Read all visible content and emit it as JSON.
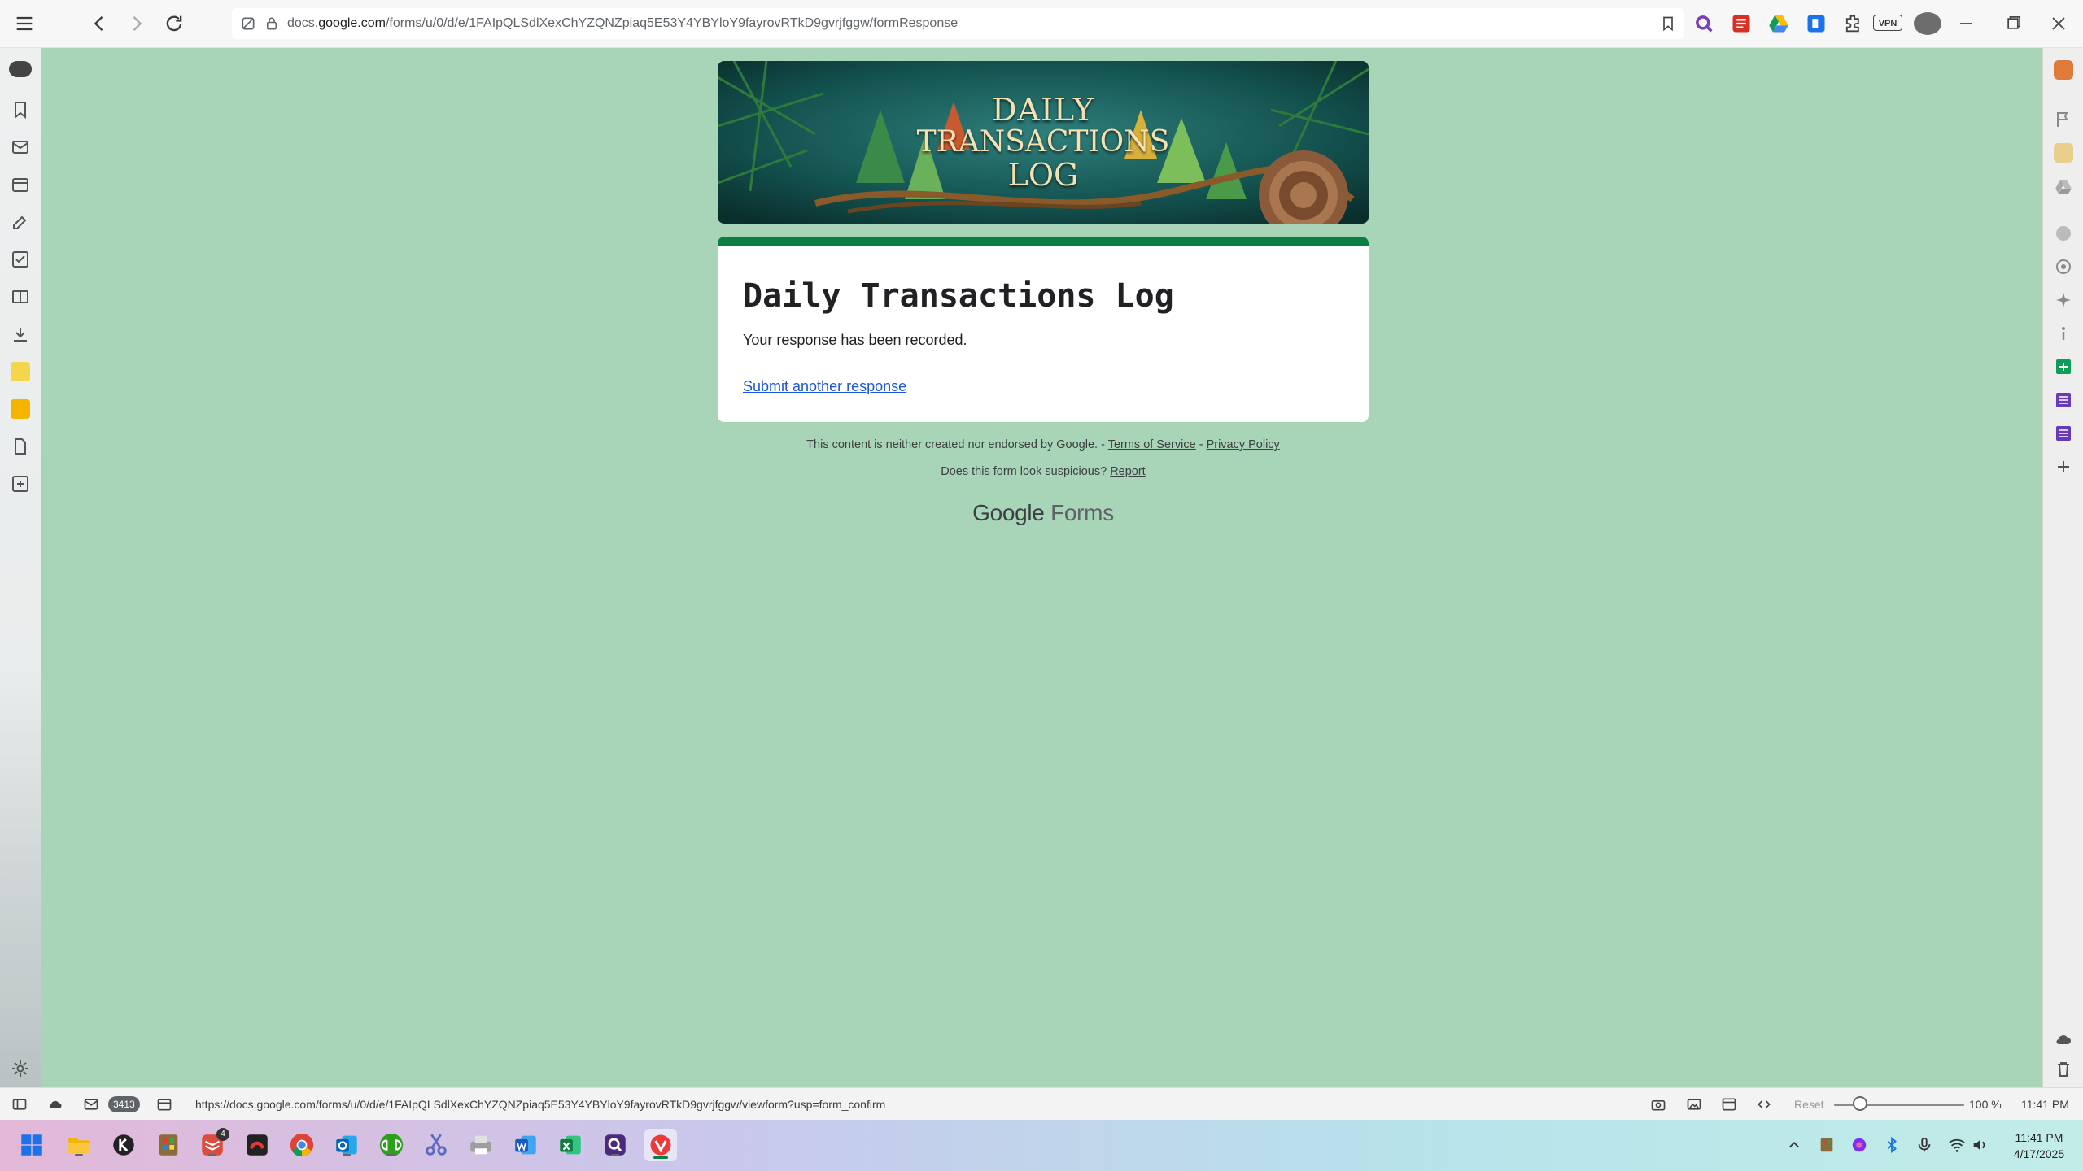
{
  "browser": {
    "url_host_prefix": "docs.",
    "url_host": "google.com",
    "url_path": "/forms/u/0/d/e/1FAIpQLSdlXexChYZQNZpiaq5E53Y4YBYloY9fayrovRTkD9gvrjfggw/formResponse",
    "icons": [
      "menu-icon",
      "back-icon",
      "forward-icon",
      "reload-icon",
      "site-info-icon",
      "lock-icon",
      "bookmark-icon"
    ],
    "extensions": [
      "search-extension-icon",
      "pdf-extension-icon",
      "drive-extension-icon",
      "extension-badge-icon",
      "puzzle-icon"
    ],
    "vpn_label": "VPN"
  },
  "form": {
    "banner_line1": "DAILY",
    "banner_line2": "TRANSACTIONS",
    "banner_line3": "LOG",
    "title": "Daily Transactions Log",
    "confirmation": "Your response has been recorded.",
    "another_link": "Submit another response",
    "accent_color": "#0b8043",
    "background_color": "#a8d5b7"
  },
  "footer": {
    "disclaimer": "This content is neither created nor endorsed by Google. - ",
    "terms": "Terms of Service",
    "separator": " - ",
    "privacy": "Privacy Policy",
    "suspicious": "Does this form look suspicious? ",
    "report": "Report",
    "brand_google": "Google",
    "brand_forms": "Forms"
  },
  "statusbar": {
    "mail_count": "3413",
    "link_url": "https://docs.google.com/forms/u/0/d/e/1FAIpQLSdlXexChYZQNZpiaq5E53Y4YBYloY9fayrovRTkD9gvrjfggw/viewform?usp=form_confirm",
    "reset_label": "Reset",
    "zoom_level": "100 %",
    "zoom_fraction": 0.2,
    "clock": "11:41 PM"
  },
  "taskbar": {
    "time": "11:41 PM",
    "date": "4/17/2025",
    "badge_count": "4"
  }
}
